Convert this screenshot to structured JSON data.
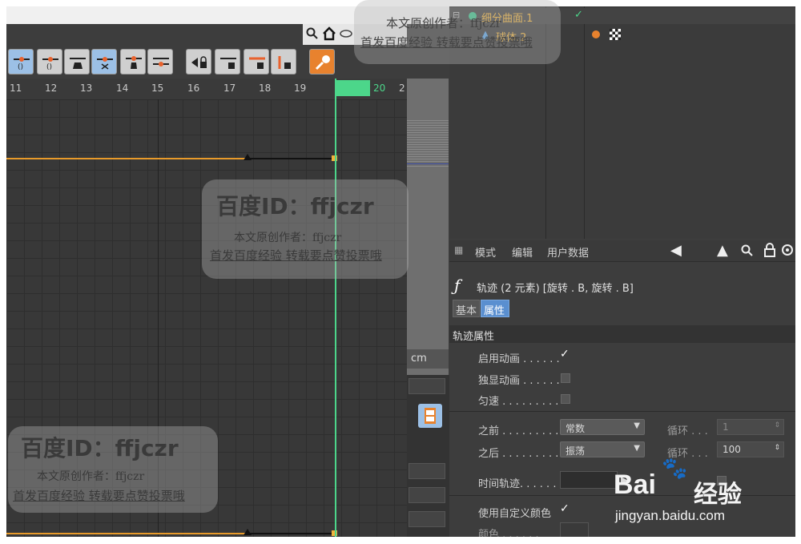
{
  "timeline": {
    "ruler_ticks": [
      "11",
      "12",
      "13",
      "14",
      "15",
      "16",
      "17",
      "18",
      "19",
      "20",
      "2"
    ],
    "current_frame": "20"
  },
  "object_manager": {
    "objects": [
      {
        "name": "细分曲面.1",
        "color": "#f0b43c"
      },
      {
        "name": "球体.2",
        "color": "#f0b43c"
      }
    ]
  },
  "viewport": {
    "unit_label": "cm"
  },
  "attribute_manager": {
    "menu": [
      "模式",
      "编辑",
      "用户数据"
    ],
    "track_title": "轨迹 (2 元素) [旋转 . B, 旋转 . B]",
    "tabs": [
      "基本",
      "属性"
    ],
    "section_title": "轨迹属性",
    "fields": {
      "enable_animation": "启用动画 . . . . . .",
      "solo_animation": "独显动画 . . . . . .",
      "constant_speed": "匀速 . . . . . . . . .",
      "before": "之前 . . . . . . . . .",
      "before_value": "常数",
      "after": "之后 . . . . . . . . .",
      "after_value": "振荡",
      "cycle_label_1": "循环 . . .",
      "cycle_value_1": "1",
      "cycle_label_2": "循环 . . .",
      "cycle_value_2": "100",
      "time_track": "时间轨迹. . . . . .",
      "use_custom_color": "使用自定义颜色",
      "color": "颜色 . . . . . ."
    }
  },
  "watermarks": {
    "id_text": "百度ID：ffjczr",
    "author_line": "本文原创作者：ffjczr",
    "promo_line": "首发百度经验  转载要点赞投票哦",
    "top_author": "本文原创作者：ffjczr",
    "top_promo": "首发百度经验  转载要点赞投票哦"
  },
  "logo": {
    "brand": "Bai",
    "brand_cn": "经验",
    "url": "jingyan.baidu.com"
  },
  "colors": {
    "accent_green": "#4cd68a",
    "curve_orange": "#e89a2a",
    "button_blue": "#9cc0e6",
    "button_orange": "#e8822e",
    "tab_active": "#5a8fd0"
  }
}
